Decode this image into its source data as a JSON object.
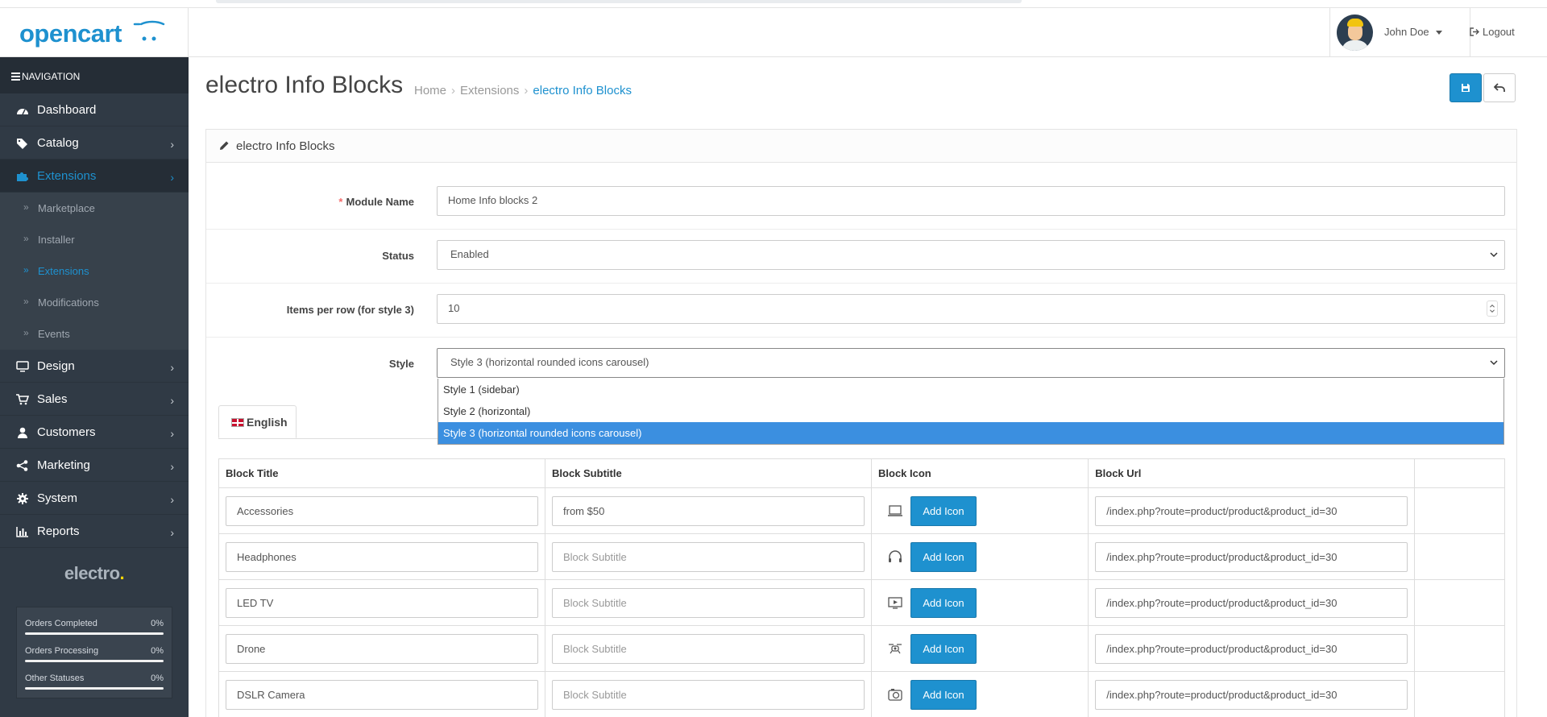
{
  "header": {
    "logo": "opencart",
    "user_name": "John Doe",
    "logout_label": "Logout"
  },
  "sidebar": {
    "nav_title": "NAVIGATION",
    "items": [
      {
        "label": "Dashboard",
        "icon": "dashboard-icon"
      },
      {
        "label": "Catalog",
        "icon": "tags-icon"
      },
      {
        "label": "Extensions",
        "icon": "puzzle-icon",
        "active": true
      },
      {
        "label": "Design",
        "icon": "desktop-icon"
      },
      {
        "label": "Sales",
        "icon": "cart-icon"
      },
      {
        "label": "Customers",
        "icon": "user-icon"
      },
      {
        "label": "Marketing",
        "icon": "share-icon"
      },
      {
        "label": "System",
        "icon": "cog-icon"
      },
      {
        "label": "Reports",
        "icon": "bar-chart-icon"
      }
    ],
    "sub_items": [
      "Marketplace",
      "Installer",
      "Extensions",
      "Modifications",
      "Events"
    ],
    "brand": "electro",
    "brand_dot": ".",
    "stats": [
      {
        "label": "Orders Completed",
        "value": "0%",
        "progress": 0
      },
      {
        "label": "Orders Processing",
        "value": "0%",
        "progress": 0
      },
      {
        "label": "Other Statuses",
        "value": "0%",
        "progress": 0
      }
    ]
  },
  "page": {
    "title": "electro Info Blocks",
    "breadcrumb": [
      "Home",
      "Extensions",
      "electro Info Blocks"
    ],
    "panel_title": "electro Info Blocks"
  },
  "form": {
    "module_name_label": "Module Name",
    "module_name_value": "Home Info blocks 2",
    "status_label": "Status",
    "status_value": "Enabled",
    "items_label": "Items per row (for style 3)",
    "items_value": "10",
    "style_label": "Style",
    "style_value": "Style 3 (horizontal rounded icons carousel)",
    "style_options": [
      "Style 1 (sidebar)",
      "Style 2 (horizontal)",
      "Style 3 (horizontal rounded icons carousel)"
    ]
  },
  "tab": {
    "label": "English"
  },
  "table": {
    "headers": [
      "Block Title",
      "Block Subtitle",
      "Block Icon",
      "Block Url"
    ],
    "subtitle_placeholder": "Block Subtitle",
    "add_icon_label": "Add Icon",
    "rows": [
      {
        "title": "Accessories",
        "subtitle": "from $50",
        "icon": "laptop-icon",
        "url": "/index.php?route=product/product&product_id=30"
      },
      {
        "title": "Headphones",
        "subtitle": "",
        "icon": "headphones-icon",
        "url": "/index.php?route=product/product&product_id=30"
      },
      {
        "title": "LED TV",
        "subtitle": "",
        "icon": "tv-icon",
        "url": "/index.php?route=product/product&product_id=30"
      },
      {
        "title": "Drone",
        "subtitle": "",
        "icon": "drone-icon",
        "url": "/index.php?route=product/product&product_id=30"
      },
      {
        "title": "DSLR Camera",
        "subtitle": "",
        "icon": "camera-icon",
        "url": "/index.php?route=product/product&product_id=30"
      }
    ]
  },
  "colors": {
    "accent": "#1e91cf",
    "sidebar": "#303a45",
    "brand_dot": "#fed700"
  }
}
